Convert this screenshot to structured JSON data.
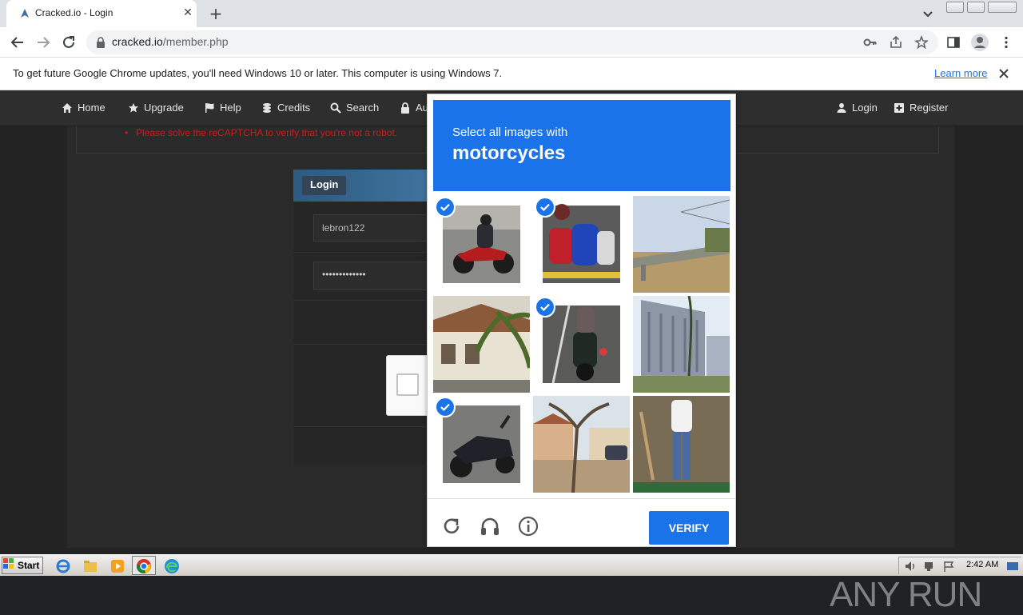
{
  "browser": {
    "tab_title": "Cracked.io - Login",
    "url_domain": "cracked.io",
    "url_path": "/member.php",
    "infobar_text": "To get future Google Chrome updates, you'll need Windows 10 or later. This computer is using Windows 7.",
    "infobar_link": "Learn more"
  },
  "site": {
    "nav_left": [
      {
        "label": "Home",
        "icon": "home-icon"
      },
      {
        "label": "Upgrade",
        "icon": "star-icon"
      },
      {
        "label": "Help",
        "icon": "flag-icon"
      },
      {
        "label": "Credits",
        "icon": "coins-icon"
      },
      {
        "label": "Search",
        "icon": "search-icon"
      },
      {
        "label": "Au",
        "icon": "lock-icon"
      }
    ],
    "nav_right": [
      {
        "label": "Login",
        "icon": "user-icon"
      },
      {
        "label": "Register",
        "icon": "plus-square-icon"
      }
    ],
    "error_message": "Please solve the reCAPTCHA to verify that you're not a robot.",
    "login_title": "Login",
    "username_value": "lebron122",
    "password_value": "•••••••••••••"
  },
  "captcha": {
    "prompt_line1": "Select all images with",
    "prompt_target": "motorcycles",
    "verify_label": "VERIFY",
    "tiles": [
      {
        "content": "motorcycle rider",
        "selected": true
      },
      {
        "content": "blue scooters",
        "selected": true
      },
      {
        "content": "highway overpass",
        "selected": false
      },
      {
        "content": "house with palm",
        "selected": false
      },
      {
        "content": "motorcycle on road",
        "selected": true
      },
      {
        "content": "office building",
        "selected": false
      },
      {
        "content": "parked motorcycle",
        "selected": true
      },
      {
        "content": "street with trees",
        "selected": false
      },
      {
        "content": "shop mannequin",
        "selected": false
      }
    ],
    "footer_icons": [
      "reload-icon",
      "audio-icon",
      "info-icon"
    ]
  },
  "watermark": "ANY RUN",
  "taskbar": {
    "start_label": "Start",
    "apps": [
      "ie-icon",
      "explorer-icon",
      "media-player-icon",
      "chrome-icon",
      "edge-icon"
    ],
    "clock": "2:42 AM"
  },
  "colors": {
    "captcha_blue": "#1a73e8",
    "error_red": "#d11919",
    "site_bg": "#232323"
  }
}
